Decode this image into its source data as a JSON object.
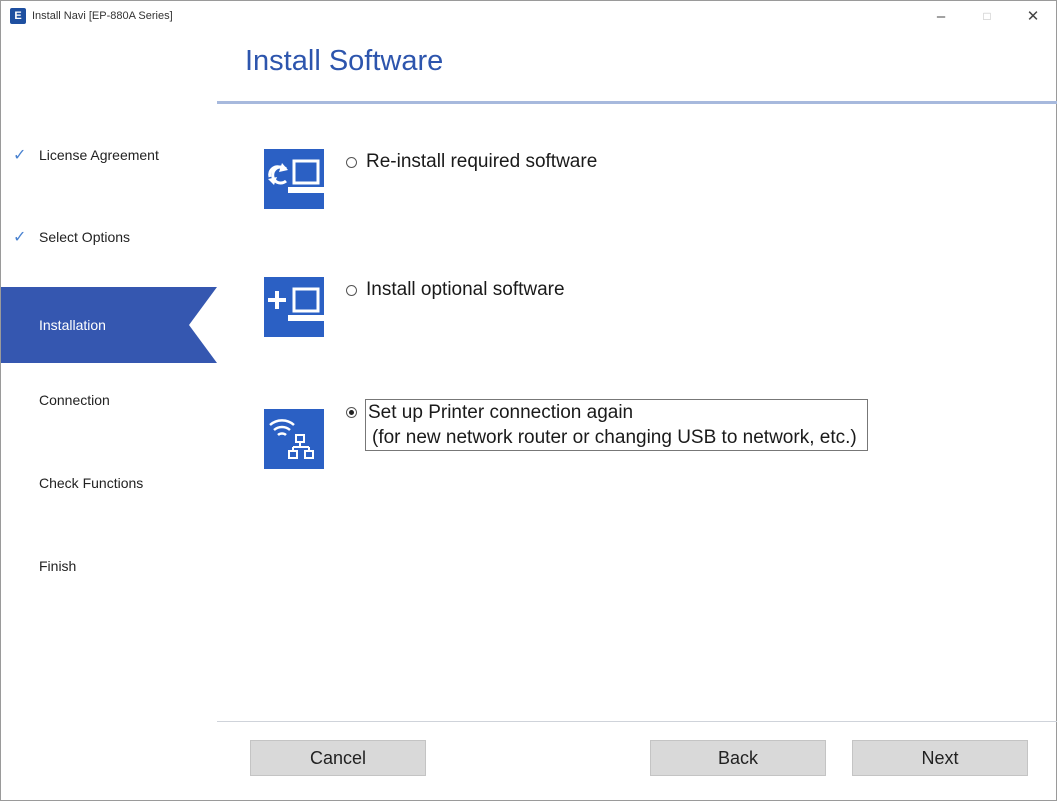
{
  "window": {
    "app_icon_glyph": "E",
    "title": "Install Navi [EP-880A Series]",
    "controls": {
      "minimize": "–",
      "maximize": "□",
      "close": "✕"
    }
  },
  "sidebar": {
    "steps": [
      {
        "label": "License Agreement",
        "state": "done",
        "check": "✓"
      },
      {
        "label": "Select Options",
        "state": "done",
        "check": "✓"
      },
      {
        "label": "Installation",
        "state": "active"
      },
      {
        "label": "Connection",
        "state": "pending"
      },
      {
        "label": "Check Functions",
        "state": "pending"
      },
      {
        "label": "Finish",
        "state": "pending"
      }
    ]
  },
  "main": {
    "title": "Install Software",
    "options": [
      {
        "label": "Re-install required software",
        "selected": false,
        "icon": "reinstall-computer-icon"
      },
      {
        "label": "Install optional software",
        "selected": false,
        "icon": "add-software-computer-icon"
      },
      {
        "label": "Set up Printer connection again",
        "sublabel": "(for new network router or changing USB to network, etc.)",
        "selected": true,
        "icon": "wifi-network-icon"
      }
    ]
  },
  "footer": {
    "cancel_label": "Cancel",
    "back_label": "Back",
    "next_label": "Next"
  },
  "colors": {
    "accent": "#2d55ad",
    "sidebar_active": "#3557b0",
    "icon_bg": "#2b60c4",
    "check": "#4a82d0"
  }
}
